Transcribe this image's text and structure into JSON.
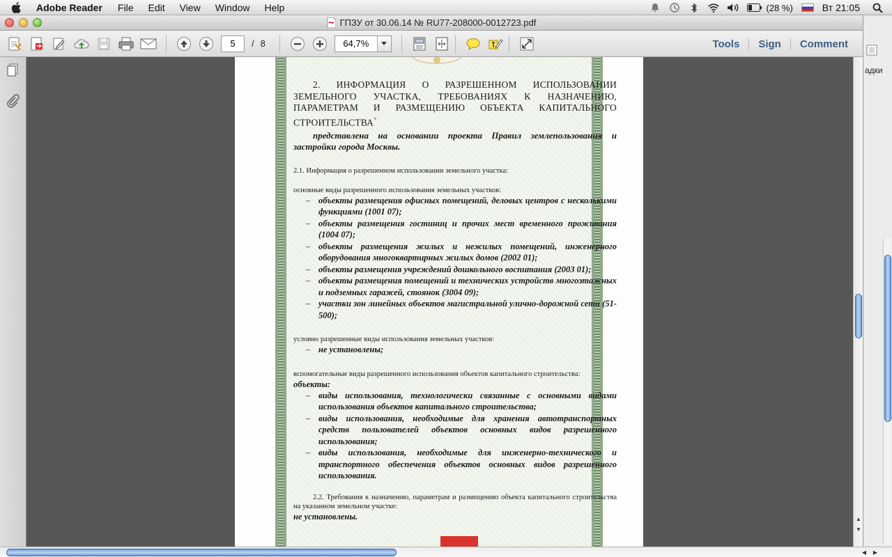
{
  "menubar": {
    "app": "Adobe Reader",
    "items": [
      "File",
      "Edit",
      "View",
      "Window",
      "Help"
    ],
    "battery": "(28 %)",
    "clock": "Вт 21:05"
  },
  "window": {
    "title": "ГПЗУ от 30.06.14 № RU77-208000-0012723.pdf"
  },
  "toolbar": {
    "page_current": "5",
    "page_sep": "/",
    "page_total": "8",
    "zoom": "64,7%",
    "tools": "Tools",
    "sign": "Sign",
    "comment": "Comment"
  },
  "bg_window": {
    "tab_fragment": "адки"
  },
  "document": {
    "section_title": "2. ИНФОРМАЦИЯ О РАЗРЕШЕННОМ ИСПОЛЬЗОВАНИИ ЗЕМЕЛЬНОГО УЧАСТКА, ТРЕБОВАНИЯХ К НАЗНАЧЕНИЮ, ПАРАМЕТРАМ И РАЗМЕЩЕНИЮ ОБЪЕКТА КАПИТАЛЬНОГО СТРОИТЕЛЬСТВА",
    "asterisk": "*",
    "basis": "представлена на основании проекта Правил землепользования и застройки города Москвы.",
    "subsection_1": "2.1. Информация о разрешенном использовании  земельного участка:",
    "main_uses_label": "основные виды разрешенного использования земельных участков:",
    "main_uses": [
      "объекты размещения офисных помещений, деловых центров с несколькими функциями (1001 07);",
      "объекты размещения гостиниц и прочих мест временного проживания (1004 07);",
      "объекты размещения жилых и нежилых помещений, инженерного оборудования многоквартирных жилых домов (2002 01);",
      "объекты размещения учреждений дошкольного воспитания (2003 01);",
      "объекты размещения помещений и технических устройств многоэтажных и подземных гаражей, стоянок (3004 09);",
      "участки зон линейных объектов магистральной улично-дорожной сети (51-500);"
    ],
    "conditional_label": "условно разрешенные виды использования земельных участков:",
    "conditional_uses": [
      "не установлены;"
    ],
    "auxiliary_label": "вспомогательные виды разрешенного использования объектов капитального строительства:",
    "objects_label": "объекты:",
    "auxiliary_uses": [
      "виды использования, технологически связанные с основными видами использования объектов капитального строительства;",
      "виды использования, необходимые для хранения автотранспортных средств пользователей объектов основных видов разрешенного использования;",
      "виды использования, необходимые для инженерно-технического и транспортного обеспечения объектов основных видов разрешенного использования."
    ],
    "subsection_2": "2.2. Требования к назначению, параметрам и размещению объекта капитального строительства на указанном земельном участке:",
    "subsection_2_value": "не установлены."
  }
}
